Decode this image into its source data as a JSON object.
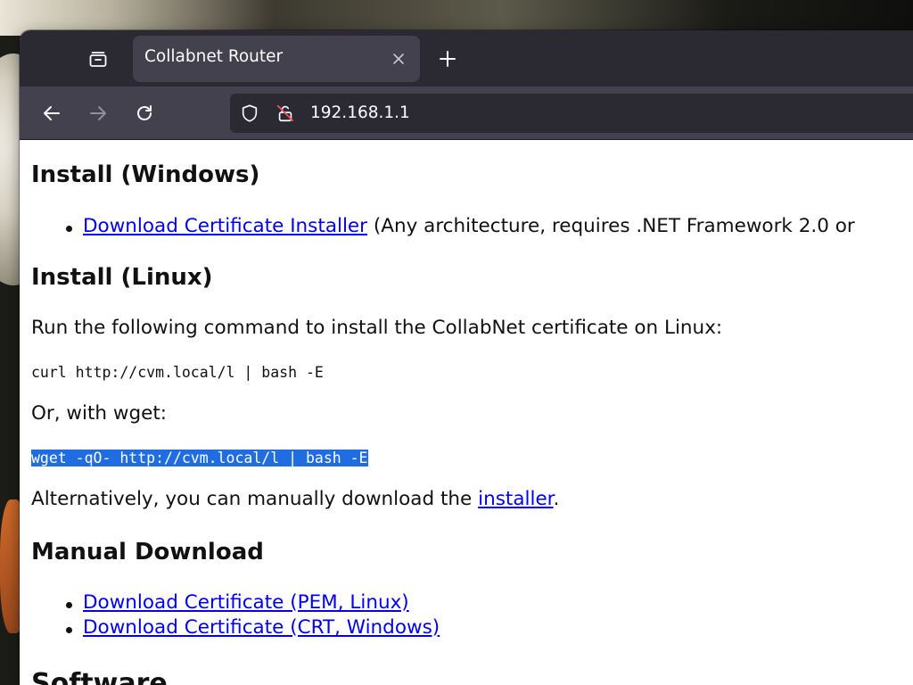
{
  "browser": {
    "tab_title": "Collabnet Router",
    "url": "192.168.1.1"
  },
  "icons": {
    "tab_overview": "tab-overview-icon",
    "close_tab": "close-icon",
    "new_tab": "plus-icon",
    "back": "arrow-left-icon",
    "forward": "arrow-right-icon",
    "reload": "reload-icon",
    "shield": "shield-icon",
    "insecure_lock": "lock-insecure-icon"
  },
  "colors": {
    "link": "#0000ee",
    "selection": "#1f6de0",
    "toolbar": "#42414d",
    "tabstrip": "#2b2a33"
  },
  "content": {
    "install_windows": {
      "heading": "Install (Windows)",
      "items": [
        {
          "link": "Download Certificate Installer",
          "note": "(Any architecture, requires .NET Framework 2.0 or"
        }
      ]
    },
    "install_linux": {
      "heading": "Install (Linux)",
      "intro": "Run the following command to install the CollabNet certificate on Linux:",
      "curl_command": "curl http://cvm.local/l | bash -E",
      "or_wget": "Or, with wget:",
      "wget_command": "wget -qO- http://cvm.local/l | bash -E",
      "alt_prefix": "Alternatively, you can manually download the ",
      "alt_link": "installer",
      "alt_suffix": "."
    },
    "manual_download": {
      "heading": "Manual Download",
      "items": [
        "Download Certificate (PEM, Linux)",
        "Download Certificate (CRT, Windows)"
      ]
    },
    "software": {
      "heading": "Software"
    }
  }
}
